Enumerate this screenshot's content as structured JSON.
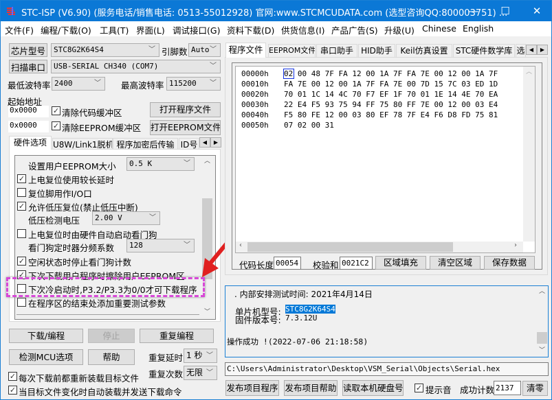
{
  "title": "STC-ISP (V6.90) (服务电话/销售电话: 0513-55012928) 官网:www.STCMCUDATA.com  (选型咨询QQ:800003751) ...",
  "window_controls": {
    "minimize": "—",
    "maximize": "☐",
    "close": "✕"
  },
  "menu": [
    "文件(F)",
    "编程/下载(O)",
    "工具(T)",
    "界面(L)",
    "调试接口(G)",
    "资料下载(D)",
    "供货信息(I)",
    "产品广告(S)",
    "升级(U)",
    "Chinese",
    "English"
  ],
  "left": {
    "chip_button": "芯片型号",
    "chip_value": "STC8G2K64S4",
    "pin_label": "引脚数",
    "pin_value": "Auto",
    "scan_button": "扫描串口",
    "port_value": "USB-SERIAL CH340 (COM7)",
    "min_baud_label": "最低波特率",
    "min_baud": "2400",
    "max_baud_label": "最高波特率",
    "max_baud": "115200",
    "start_addr_label": "起始地址",
    "addr1": "0x0000",
    "clear_code": "清除代码缓冲区",
    "open_prog": "打开程序文件",
    "addr2": "0x0000",
    "clear_eeprom": "清除EEPROM缓冲区",
    "open_eeprom": "打开EEPROM文件",
    "tabs": [
      "硬件选项",
      "U8W/Link1脱机",
      "程序加密后传输",
      "ID号"
    ],
    "options": [
      {
        "label": "设置用户EEPROM大小",
        "type": "select",
        "value": "0.5 K"
      },
      {
        "label": "上电复位使用较长延时",
        "type": "check",
        "checked": true
      },
      {
        "label": "复位脚用作I/O口",
        "type": "check",
        "checked": false
      },
      {
        "label": "允许低压复位(禁止低压中断)",
        "type": "check",
        "checked": true
      },
      {
        "label": "低压检测电压",
        "type": "select",
        "value": "2.00 V"
      },
      {
        "label": "上电复位时由硬件自动启动看门狗",
        "type": "check",
        "checked": false
      },
      {
        "label": "看门狗定时器分频系数",
        "type": "select",
        "value": "128"
      },
      {
        "label": "空闲状态时停止看门狗计数",
        "type": "check",
        "checked": true
      },
      {
        "label": "下次下载用户程序时擦除用户EEPROM区",
        "type": "check",
        "checked": true
      },
      {
        "label": "下次冷启动时,P3.2/P3.3为0/0才可下载程序",
        "type": "check",
        "checked": false,
        "highlighted": true
      },
      {
        "label": "在程序区的结束处添加重要测试参数",
        "type": "check",
        "checked": false
      }
    ],
    "download": "下载/编程",
    "stop": "停止",
    "repeat": "重复编程",
    "detect": "检测MCU选项",
    "help": "帮助",
    "repeat_delay_label": "重复延时",
    "repeat_delay": "1 秒",
    "repeat_count_label": "重复次数",
    "repeat_count": "无限",
    "reload": "每次下载前都重新装载目标文件",
    "auto_send": "当目标文件变化时自动装载并发送下载命令"
  },
  "right": {
    "tabs": [
      "程序文件",
      "EEPROM文件",
      "串口助手",
      "HID助手",
      "Keil仿真设置",
      "STC硬件数学库",
      "选"
    ],
    "hex_rows": [
      {
        "addr": "00000h",
        "bytes": "02 00 48 7F FA 12 00 1A 7F FA 7E 00 12 00 1A 7F"
      },
      {
        "addr": "00010h",
        "bytes": "FA 7E 00 12 00 1A 7F FA 7E 00 7D 15 7C 03 ED 1D"
      },
      {
        "addr": "00020h",
        "bytes": "70 01 1C 14 4C 70 F7 EF 1F 70 01 1E 14 4E 70 EA"
      },
      {
        "addr": "00030h",
        "bytes": "22 E4 F5 93 75 94 FF 75 80 FF 7E 00 12 00 03 E4"
      },
      {
        "addr": "00040h",
        "bytes": "F5 80 FE 12 00 03 80 EF 78 7F E4 F6 D8 FD 75 81"
      },
      {
        "addr": "00050h",
        "bytes": "07 02 00 31"
      }
    ],
    "code_len_label": "代码长度",
    "code_len": "00054",
    "checksum_label": "校验和",
    "checksum": "0021C2",
    "fill": "区域填充",
    "clear": "清空区域",
    "save": "保存数据",
    "log": {
      "line1": ". 内部安排测试时间: 2021年4月14日",
      "mcu_label": "单片机型号:",
      "mcu": "STC8G2K64S4",
      "fw_label": "固件版本号:",
      "fw": "7.3.12U",
      "result": "操作成功 !(2022-07-06 21:18:58)"
    },
    "path": "C:\\Users\\Administrator\\Desktop\\VSM_Serial\\Objects\\Serial.hex",
    "publish_prog": "发布项目程序",
    "publish_help": "发布项目帮助",
    "read_disk": "读取本机硬盘号",
    "beep": "提示音",
    "success_label": "成功计数",
    "success_count": "2137",
    "reset": "清零"
  },
  "colors": {
    "titlebar": "#0b78d6",
    "highlight_box": "#d040d0",
    "arrow": "#e02020",
    "selection": "#0078d7"
  }
}
